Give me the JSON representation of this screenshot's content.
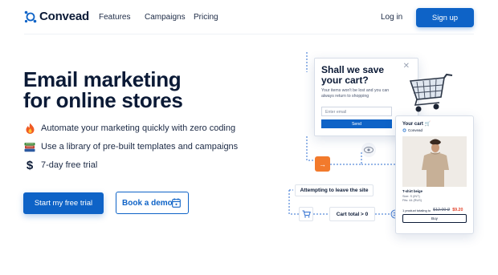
{
  "nav": {
    "logo_text": "Convead",
    "links": [
      "Features",
      "Campaigns",
      "Pricing"
    ],
    "login": "Log in",
    "signup": "Sign up"
  },
  "hero": {
    "title_line1": "Email marketing",
    "title_line2": "for online stores",
    "features": [
      {
        "icon": "fire-icon",
        "text": "Automate your marketing quickly with zero coding"
      },
      {
        "icon": "books-icon",
        "text": "Use a library of pre-built templates and campaigns"
      },
      {
        "icon": "dollar-icon",
        "text": "7-day free trial"
      }
    ],
    "cta_primary": "Start my free trial",
    "cta_secondary": "Book a demo"
  },
  "illustration": {
    "popup": {
      "title": "Shall we save your cart?",
      "subtitle": "Your items won't be lost and you can always return to shopping",
      "email_placeholder": "Enter email",
      "send": "Send"
    },
    "cart": {
      "title": "Your cart",
      "brand": "Convead",
      "product_name": "T-shirt beige",
      "product_meta_1": "Size: S (INT)",
      "product_meta_2": "Fits: 44 (RUS)",
      "total_label": "1 product totaling to",
      "old_price": "$12.00 ₽",
      "new_price": "$9.20",
      "buy": "Buy"
    },
    "flow": {
      "leave_label": "Attempting to leave the site",
      "cart_total": "Cart total > 0"
    },
    "colors": {
      "accent": "#0e63c7",
      "orange": "#f27a2c",
      "sale": "#e2452e"
    }
  }
}
